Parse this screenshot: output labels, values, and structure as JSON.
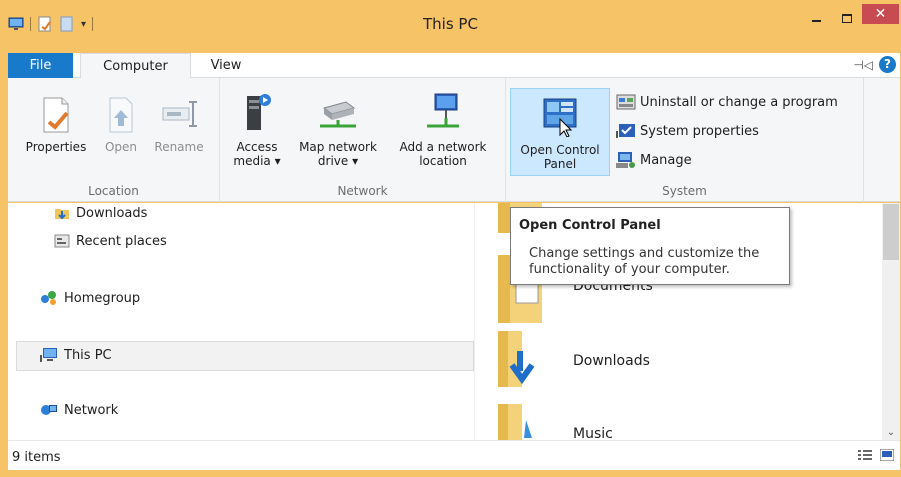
{
  "window": {
    "title": "This PC"
  },
  "quick_access": {
    "icons": [
      "computer-icon",
      "properties-icon",
      "new-folder-icon",
      "customize-dropdown-icon"
    ]
  },
  "tabs": {
    "file": "File",
    "computer": "Computer",
    "view": "View"
  },
  "ribbon": {
    "location": {
      "label": "Location",
      "properties": "Properties",
      "open": "Open",
      "rename": "Rename"
    },
    "network": {
      "label": "Network",
      "access_media_1": "Access",
      "access_media_2": "media ▾",
      "map_drive_1": "Map network",
      "map_drive_2": "drive ▾",
      "add_location_1": "Add a network",
      "add_location_2": "location"
    },
    "system": {
      "label": "System",
      "open_cp_1": "Open Control",
      "open_cp_2": "Panel",
      "uninstall": "Uninstall or change a program",
      "system_properties": "System properties",
      "manage": "Manage"
    }
  },
  "nav": {
    "downloads": "Downloads",
    "recent": "Recent places",
    "homegroup": "Homegroup",
    "this_pc": "This PC",
    "network": "Network"
  },
  "folders": {
    "documents": "Documents",
    "downloads": "Downloads",
    "music": "Music"
  },
  "tooltip": {
    "title": "Open Control Panel",
    "body": "Change settings and customize the functionality of your computer."
  },
  "status": {
    "items": "9 items"
  },
  "colors": {
    "title_bar": "#f6c366",
    "file_tab": "#1979ca",
    "close_button": "#c74b50",
    "selected_button": "#cce8ff"
  }
}
